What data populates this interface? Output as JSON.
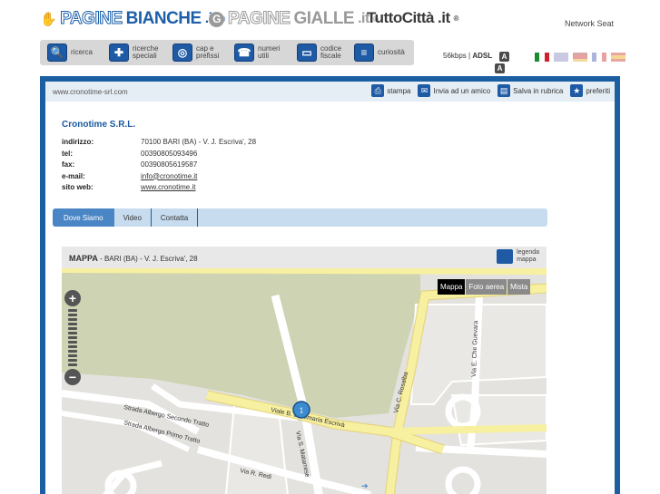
{
  "brands": {
    "paginebianche": {
      "outline": "PAGINE",
      "bold": "BIANCHE",
      "it": ".it",
      "reg": "®"
    },
    "paginegialle": {
      "outline": "PAGINE",
      "bold": "GIALLE",
      "it": ".it",
      "reg": "®"
    },
    "tuttocitta": {
      "name": "TuttoCittà",
      "it": ".it",
      "reg": "®"
    },
    "network": "Network Seat"
  },
  "nav": [
    {
      "label": "ricerca",
      "icon": "search-icon"
    },
    {
      "label": "ricerche\nspeciali",
      "icon": "special-search-icon"
    },
    {
      "label": "cap e\nprefissi",
      "icon": "globe-icon"
    },
    {
      "label": "numeri\nutili",
      "icon": "phone-icon"
    },
    {
      "label": "codice\nfiscale",
      "icon": "card-icon"
    },
    {
      "label": "curiosità",
      "icon": "curiosity-icon"
    }
  ],
  "connection": {
    "speed": "56kbps",
    "type": "ADSL",
    "font_btn_1": "A",
    "font_btn_2": "A"
  },
  "url": "www.cronotime-srl.com",
  "tools": {
    "print": "stampa",
    "send": "Invia ad un amico",
    "save": "Salva in rubrica",
    "favorites": "preferiti"
  },
  "company": {
    "name": "Cronotime S.R.L.",
    "rows": [
      {
        "key": "indirizzo:",
        "value": "70100 BARI (BA) - V. J. Escriva', 28"
      },
      {
        "key": "tel:",
        "value": "00390805093496"
      },
      {
        "key": "fax:",
        "value": "00390805619587"
      },
      {
        "key": "e-mail:",
        "value": "info@cronotime.it"
      },
      {
        "key": "sito web:",
        "value": "www.cronotime.it"
      }
    ]
  },
  "tabs": [
    "Dove Siamo",
    "Video",
    "Contatta"
  ],
  "map": {
    "title": "MAPPA",
    "address": " - BARI (BA) - V. J. Escriva', 28",
    "legenda": "legenda\nmappa",
    "types": [
      "Mappa",
      "Foto aerea",
      "Mista"
    ],
    "marker": "1",
    "streets": {
      "s1": "Strada Albergo Secondo Tratto",
      "s2": "Strada Albergo Primo Tratto",
      "s3": "Viale B. Josemaria Escrivà",
      "s4": "Via S. Matarrese",
      "s5": "Via C. Rosalba",
      "s6": "Via E. Che Guevara",
      "s7": "Via R. Redi"
    }
  },
  "colors": {
    "brand_blue": "#1b5fa0",
    "map_park": "#cdd3b3",
    "road_yellow": "#f7f0a0"
  }
}
